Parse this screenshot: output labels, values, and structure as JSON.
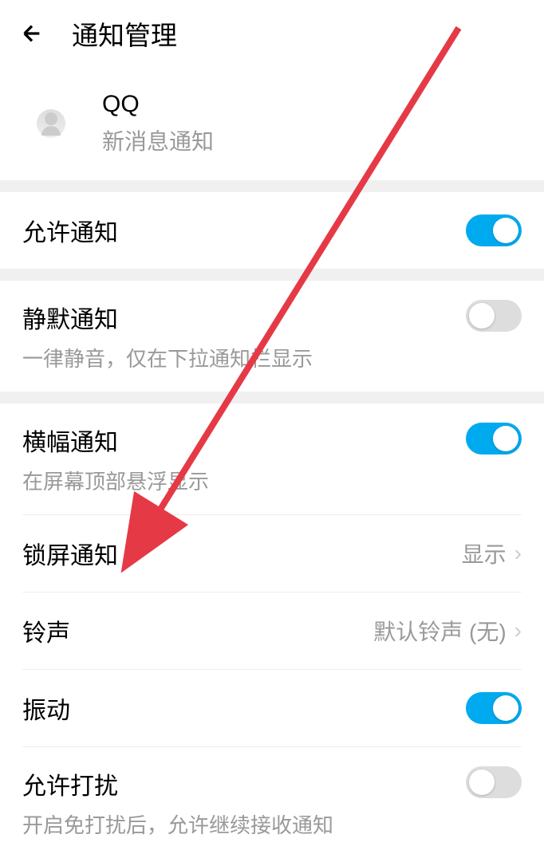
{
  "header": {
    "title": "通知管理"
  },
  "app": {
    "name": "QQ",
    "subtitle": "新消息通知"
  },
  "settings": {
    "allow_notification": {
      "title": "允许通知",
      "enabled": true
    },
    "silent_notification": {
      "title": "静默通知",
      "subtitle": "一律静音，仅在下拉通知栏显示",
      "enabled": false
    },
    "banner_notification": {
      "title": "横幅通知",
      "subtitle": "在屏幕顶部悬浮显示",
      "enabled": true
    },
    "lock_screen_notification": {
      "title": "锁屏通知",
      "value": "显示"
    },
    "ringtone": {
      "title": "铃声",
      "value": "默认铃声 (无)"
    },
    "vibration": {
      "title": "振动",
      "enabled": true
    },
    "allow_disturb": {
      "title": "允许打扰",
      "subtitle": "开启免打扰后，允许继续接收通知",
      "enabled": false
    }
  }
}
